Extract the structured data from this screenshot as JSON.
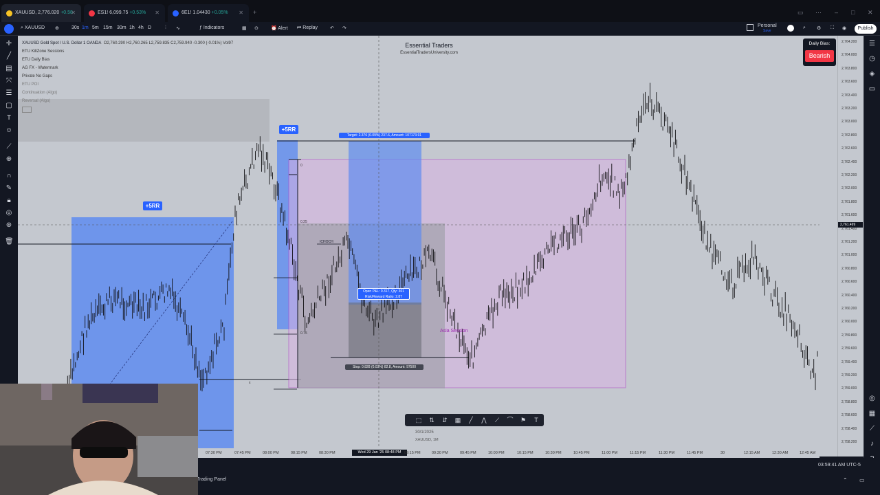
{
  "tabs": [
    {
      "symbol": "XAUUSD",
      "price": "2,776.020",
      "change": "+0.58",
      "dot_color": "#f7c325",
      "change_class": "chg"
    },
    {
      "symbol": "ES1!",
      "price": "6,099.75",
      "change": "+0.53%",
      "dot_color": "#f23645",
      "change_class": "chg"
    },
    {
      "symbol": "6E1!",
      "price": "1.04430",
      "change": "+0.05%",
      "dot_color": "#2962ff",
      "change_class": "chg"
    }
  ],
  "toolbar": {
    "symbol": "XAUUSD",
    "intervals": [
      "30s",
      "1m",
      "5m",
      "15m",
      "30m",
      "1h",
      "4h",
      "D"
    ],
    "indicators": "Indicators",
    "alert": "Alert",
    "replay": "Replay",
    "layout": "Personal",
    "layout_sub": "Save",
    "publish": "Publish"
  },
  "legend": {
    "title": "XAUUSD  Gold Spot / U.S. Dollar  1  OANDA",
    "ohlc": "O2,760.290  H2,760.265  L2,759.835  C2,759.940  -0.300  (-0.01%)  Vol97",
    "indicators": [
      "ETU KillZone Sessions",
      "ETU Daily Bias",
      "AG FX - Watermark",
      "Private No Gaps",
      "ETU POI",
      "Continuation (Algo)",
      "Reversal (Algo)"
    ]
  },
  "watermark": {
    "title": "Essential Traders",
    "url": "EssentialTradersUniversity.com"
  },
  "bias": {
    "label": "Daily Bias:",
    "value": "Bearish",
    "color": "#f23645"
  },
  "price_axis": {
    "labels": [
      "2,764.200",
      "2,764.000",
      "2,763.800",
      "2,763.600",
      "2,763.400",
      "2,763.200",
      "2,763.000",
      "2,762.800",
      "2,762.600",
      "2,762.400",
      "2,762.200",
      "2,762.000",
      "2,761.800",
      "2,761.600",
      "2,761.400",
      "2,761.200",
      "2,761.000",
      "2,760.800",
      "2,760.600",
      "2,760.400",
      "2,760.200",
      "2,760.000",
      "2,759.800",
      "2,759.600",
      "2,759.400",
      "2,759.200",
      "2,759.000",
      "2,758.800",
      "2,758.600",
      "2,758.400",
      "2,758.200"
    ],
    "current": "2,761.499"
  },
  "time_axis": {
    "labels": [
      "7:15 PM",
      "07:30 PM",
      "07:45 PM",
      "08:00 PM",
      "08:15 PM",
      "08:30 PM",
      "09:15 PM",
      "09:30 PM",
      "09:45 PM",
      "10:00 PM",
      "10:15 PM",
      "10:30 PM",
      "10:45 PM",
      "11:00 PM",
      "11:15 PM",
      "11:30 PM",
      "11:45 PM",
      "30",
      "12:15 AM",
      "12:30 AM",
      "12:45 AM"
    ],
    "current": "Wed 29 Jan '25  08:48 PM"
  },
  "drawings": {
    "rr_left": "+5RR",
    "rr_mid": "+5RR",
    "target": "Target: 2.376 (0.09%) 237.6, Amount: 107173.91",
    "stop": "Stop: 0.828 (0.03%) 82.8, Amount: 97500",
    "open_pnl": "Open P&L: 0.317, Qty: 301",
    "rr_ratio": "Risk/Reward Ratio: 2.87",
    "session": "Asia Session",
    "choch": "ICHOCH",
    "fib_0": "0",
    "fib_025": "0.25",
    "fib_075": "0.75",
    "x_mark": "x"
  },
  "drawbar": {
    "date": "30/1/2025",
    "symbol": "XAUUSD, 1M"
  },
  "bottom": {
    "clock": "03:59:41 AM UTC-5",
    "panel": "Trading Panel"
  }
}
